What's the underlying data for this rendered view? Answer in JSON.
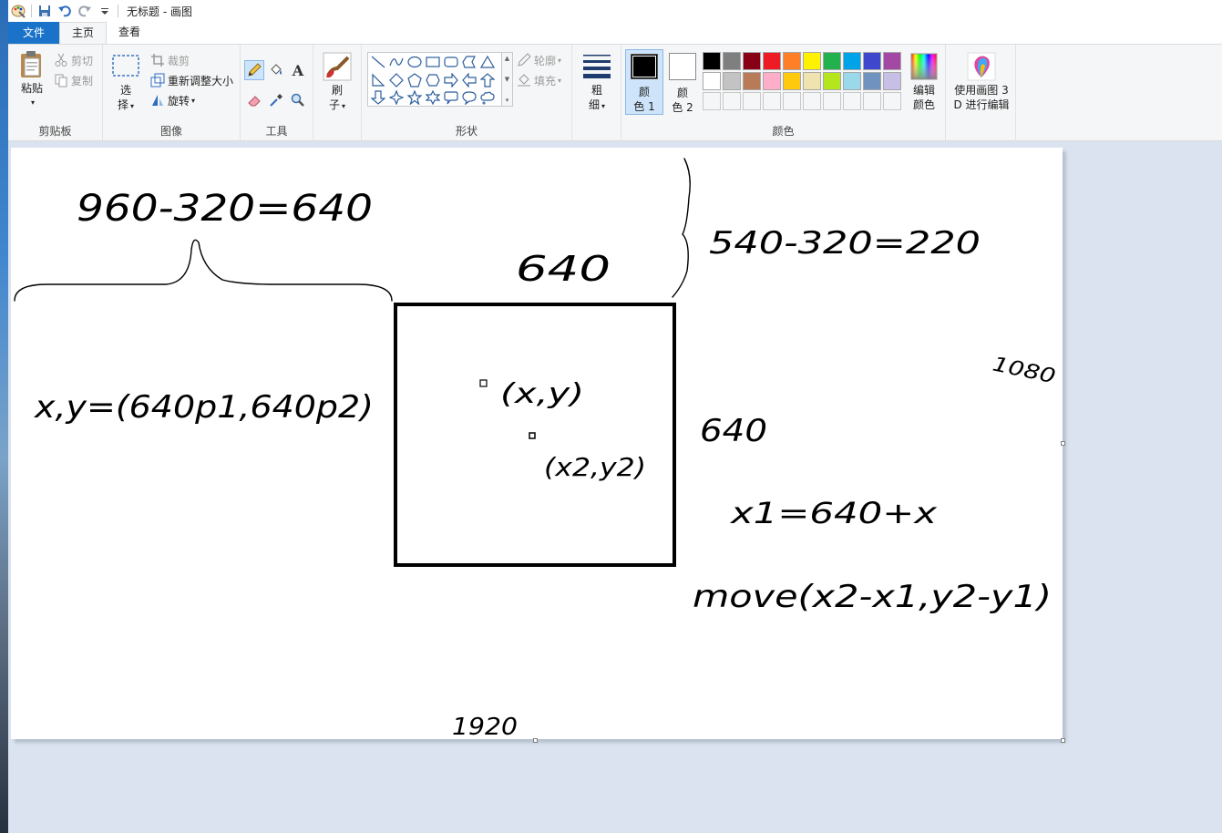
{
  "window": {
    "title": "无标题 - 画图"
  },
  "tabs": {
    "file": "文件",
    "home": "主页",
    "view": "查看"
  },
  "clipboard": {
    "paste": "粘贴",
    "cut": "剪切",
    "copy": "复制",
    "label": "剪贴板"
  },
  "image": {
    "select_line1": "选",
    "select_line2": "择",
    "crop": "裁剪",
    "resize": "重新调整大小",
    "rotate": "旋转",
    "label": "图像"
  },
  "tools": {
    "label": "工具",
    "text_glyph": "A",
    "selected": "pencil"
  },
  "brushes": {
    "line1": "刷",
    "line2": "子"
  },
  "shapes": {
    "outline": "轮廓",
    "fill": "填充",
    "label": "形状"
  },
  "size": {
    "line1": "粗",
    "line2": "细"
  },
  "colors": {
    "color1_line1": "颜",
    "color1_line2": "色 1",
    "color2_line1": "颜",
    "color2_line2": "色 2",
    "edit_line1": "编辑",
    "edit_line2": "颜色",
    "label": "颜色",
    "color1_value": "#000000",
    "color2_value": "#ffffff",
    "palette": [
      "#000000",
      "#7f7f7f",
      "#880015",
      "#ed1c24",
      "#ff7f27",
      "#fff200",
      "#22b14c",
      "#00a2e8",
      "#3f48cc",
      "#a349a4",
      "#ffffff",
      "#c3c3c3",
      "#b97a57",
      "#ffaec9",
      "#ffc90e",
      "#efe4b0",
      "#b5e61d",
      "#99d9ea",
      "#7092be",
      "#c8bfe7",
      "",
      "",
      "",
      "",
      "",
      "",
      "",
      "",
      "",
      ""
    ]
  },
  "paint3d": {
    "line1": "使用画图 3",
    "line2": "D 进行编辑"
  },
  "canvas_notes": {
    "left_top": "960-320=640",
    "center_top": "640",
    "right_top": "540-320=220",
    "right_edge": "1080",
    "left_formula": "x,y=(640p1,640p2)",
    "point1": "(x,y)",
    "point2": "(x2,y2)",
    "right_mid": "640",
    "right_formula1": "x1=640+x",
    "right_formula2": "move(x2-x1,y2-y1)",
    "bottom": "1920"
  }
}
